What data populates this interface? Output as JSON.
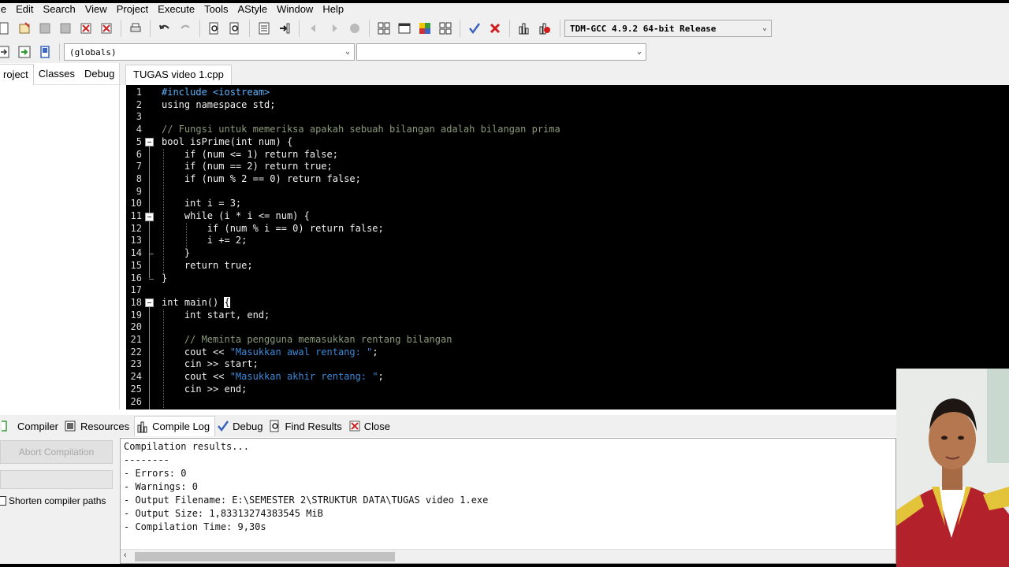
{
  "menu": [
    "le",
    "Edit",
    "Search",
    "View",
    "Project",
    "Execute",
    "Tools",
    "AStyle",
    "Window",
    "Help"
  ],
  "toolbar": {
    "compiler_select": "TDM-GCC 4.9.2 64-bit Release",
    "scope_select": "(globals)",
    "member_select": ""
  },
  "left_panel": {
    "tabs": [
      "roject",
      "Classes",
      "Debug"
    ]
  },
  "editor": {
    "file_tab": "TUGAS video 1.cpp",
    "lines": [
      {
        "n": "1",
        "text": "#include <iostream>"
      },
      {
        "n": "2",
        "text": "using namespace std;"
      },
      {
        "n": "3",
        "text": ""
      },
      {
        "n": "4",
        "text": "// Fungsi untuk memeriksa apakah sebuah bilangan adalah bilangan prima"
      },
      {
        "n": "5",
        "text": "bool isPrime(int num) {"
      },
      {
        "n": "6",
        "text": "    if (num <= 1) return false;"
      },
      {
        "n": "7",
        "text": "    if (num == 2) return true;"
      },
      {
        "n": "8",
        "text": "    if (num % 2 == 0) return false;"
      },
      {
        "n": "9",
        "text": ""
      },
      {
        "n": "10",
        "text": "    int i = 3;"
      },
      {
        "n": "11",
        "text": "    while (i * i <= num) {"
      },
      {
        "n": "12",
        "text": "        if (num % i == 0) return false;"
      },
      {
        "n": "13",
        "text": "        i += 2;"
      },
      {
        "n": "14",
        "text": "    }"
      },
      {
        "n": "15",
        "text": "    return true;"
      },
      {
        "n": "16",
        "text": "}"
      },
      {
        "n": "17",
        "text": ""
      },
      {
        "n": "18",
        "text": "int main() {"
      },
      {
        "n": "19",
        "text": "    int start, end;"
      },
      {
        "n": "20",
        "text": ""
      },
      {
        "n": "21",
        "text": "    // Meminta pengguna memasukkan rentang bilangan"
      },
      {
        "n": "22",
        "text": "    cout << \"Masukkan awal rentang: \";"
      },
      {
        "n": "23",
        "text": "    cin >> start;"
      },
      {
        "n": "24",
        "text": "    cout << \"Masukkan akhir rentang: \";"
      },
      {
        "n": "25",
        "text": "    cin >> end;"
      },
      {
        "n": "26",
        "text": ""
      }
    ]
  },
  "bottom_tabs": [
    {
      "label": "Compiler",
      "icon": "compiler-icon"
    },
    {
      "label": "Resources",
      "icon": "resources-icon"
    },
    {
      "label": "Compile Log",
      "icon": "chart-icon"
    },
    {
      "label": "Debug",
      "icon": "check-icon"
    },
    {
      "label": "Find Results",
      "icon": "find-icon"
    },
    {
      "label": "Close",
      "icon": "close-icon"
    }
  ],
  "bottom_left": {
    "abort_label": "Abort Compilation",
    "shorten_label": "Shorten compiler paths",
    "shorten_checked": false
  },
  "log": {
    "lines": [
      "Compilation results...",
      "--------",
      "- Errors: 0",
      "- Warnings: 0",
      "- Output Filename: E:\\SEMESTER 2\\STRUKTUR DATA\\TUGAS video 1.exe",
      "- Output Size: 1,83313274383545 MiB",
      "- Compilation Time: 9,30s"
    ]
  },
  "colors": {
    "editor_bg": "#000000",
    "preprocessor": "#5fb4ff",
    "comment": "#8a9a7a",
    "string": "#3c8ad8",
    "chrome": "#f0f0f0"
  }
}
